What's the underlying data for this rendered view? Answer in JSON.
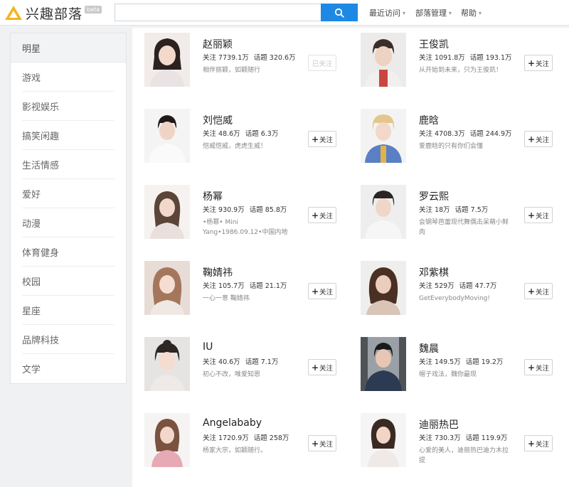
{
  "app": {
    "logo_text": "兴趣部落",
    "logo_badge": "beta"
  },
  "search": {
    "value": "",
    "placeholder": ""
  },
  "nav": [
    {
      "label": "最近访问"
    },
    {
      "label": "部落管理"
    },
    {
      "label": "帮助"
    }
  ],
  "sidebar": {
    "items": [
      {
        "label": "明星",
        "active": true
      },
      {
        "label": "游戏"
      },
      {
        "label": "影视娱乐"
      },
      {
        "label": "搞笑闲趣"
      },
      {
        "label": "生活情感"
      },
      {
        "label": "爱好"
      },
      {
        "label": "动漫"
      },
      {
        "label": "体育健身"
      },
      {
        "label": "校园"
      },
      {
        "label": "星座"
      },
      {
        "label": "品牌科技"
      },
      {
        "label": "文学"
      }
    ]
  },
  "labels": {
    "follow": "关注",
    "followed": "已关注"
  },
  "cards": [
    {
      "name": "赵丽颖",
      "fans": "关注 7739.1万",
      "topics": "话题 320.6万",
      "desc": "相伴丽颖，如颖随行",
      "followed": true
    },
    {
      "name": "王俊凯",
      "fans": "关注 1091.8万",
      "topics": "话题 193.1万",
      "desc": "从开始到未来，只为王俊凯！",
      "followed": false
    },
    {
      "name": "刘恺威",
      "fans": "关注 48.6万",
      "topics": "话题 6.3万",
      "desc": "恺威恺威，虎虎生威！",
      "followed": false
    },
    {
      "name": "鹿晗",
      "fans": "关注 4708.3万",
      "topics": "话题 244.9万",
      "desc": "爱鹿晗的只有你们会懂",
      "followed": false
    },
    {
      "name": "杨幂",
      "fans": "关注 930.9万",
      "topics": "话题 85.8万",
      "desc": "•杨幂• Mini Yang•1986.09.12•中国内地",
      "followed": false
    },
    {
      "name": "罗云熙",
      "fans": "关注 18万",
      "topics": "话题 7.5万",
      "desc": "会钢琴芭蕾现代舞偶击呆萌小鲜肉",
      "followed": false
    },
    {
      "name": "鞠婧祎",
      "fans": "关注 105.7万",
      "topics": "话题 21.1万",
      "desc": "一心一意 鞠婧祎",
      "followed": false
    },
    {
      "name": "邓紫棋",
      "fans": "关注 529万",
      "topics": "话题 47.7万",
      "desc": "GetEverybodyMoving!",
      "followed": false
    },
    {
      "name": "IU",
      "fans": "关注 40.6万",
      "topics": "话题 7.1万",
      "desc": "初心不改，唯爱知恩",
      "followed": false
    },
    {
      "name": "魏晨",
      "fans": "关注 149.5万",
      "topics": "话题 19.2万",
      "desc": "帽子戏法，魏你最现",
      "followed": false
    },
    {
      "name": "Angelababy",
      "fans": "关注 1720.9万",
      "topics": "话题 258万",
      "desc": "杨家大宗，如颖随行。",
      "followed": false
    },
    {
      "name": "迪丽热巴",
      "fans": "关注 730.3万",
      "topics": "话题 119.9万",
      "desc": "心爱的美人，迪丽热巴迪力木拉提",
      "followed": false
    }
  ]
}
